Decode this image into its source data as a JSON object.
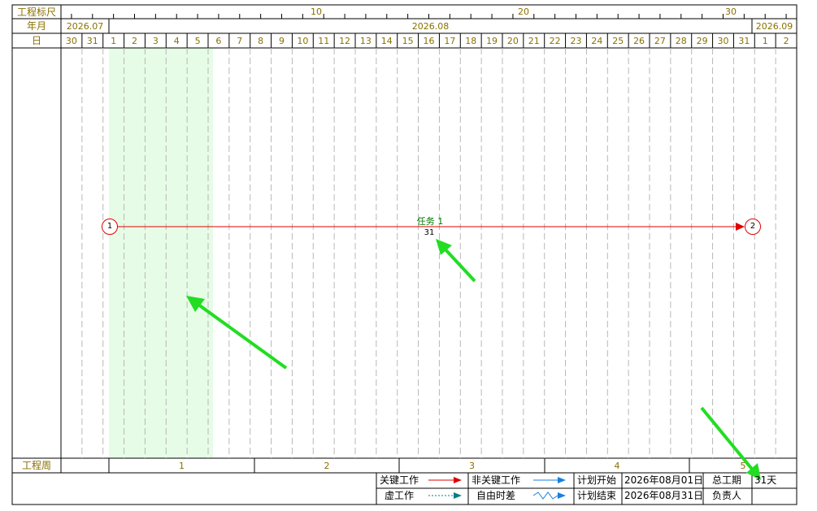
{
  "header": {
    "scale_label": "工程标尺",
    "yearmonth_label": "年月",
    "day_label": "日",
    "week_label": "工程周",
    "scale_ticks": [
      "10",
      "20",
      "30"
    ],
    "months": [
      "2026.07",
      "2026.08",
      "2026.09"
    ],
    "days": [
      "30",
      "31",
      "1",
      "2",
      "3",
      "4",
      "5",
      "6",
      "7",
      "8",
      "9",
      "10",
      "11",
      "12",
      "13",
      "14",
      "15",
      "16",
      "17",
      "18",
      "19",
      "20",
      "21",
      "22",
      "23",
      "24",
      "25",
      "26",
      "27",
      "28",
      "29",
      "30",
      "31",
      "1",
      "2"
    ],
    "weeks": [
      "1",
      "2",
      "3",
      "4",
      "5"
    ]
  },
  "task": {
    "name": "任务 1",
    "duration": "31",
    "start_node": "1",
    "end_node": "2"
  },
  "legend": {
    "critical_work": "关键工作",
    "noncritical_work": "非关键工作",
    "dummy_work": "虚工作",
    "free_float": "自由时差",
    "plan_start_label": "计划开始",
    "plan_start_value": "2026年08月01日",
    "plan_end_label": "计划结束",
    "plan_end_value": "2026年08月31日",
    "total_duration_label": "总工期",
    "total_duration_value": "31天",
    "owner_label": "负责人",
    "owner_value": ""
  },
  "colors": {
    "critical": "#e00000",
    "noncritical": "#1a7fe0",
    "dummy": "#008080",
    "highlight": "#e6fce6",
    "header_text": "#8a7000",
    "annotation": "#22dd22"
  }
}
